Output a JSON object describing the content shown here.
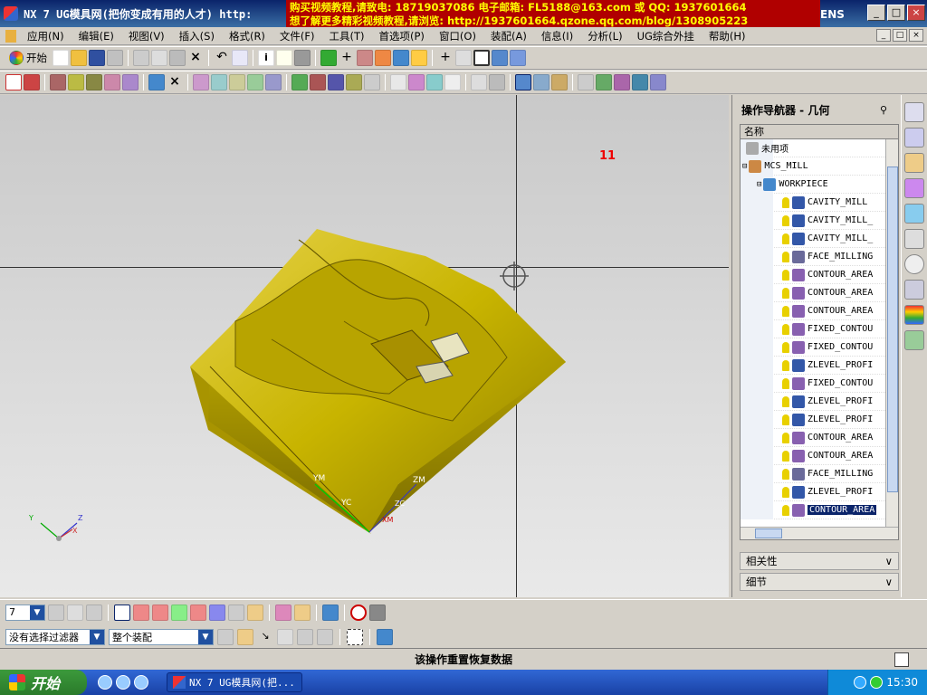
{
  "window": {
    "title": "NX 7 UG模具网(把你变成有用的人才) http:"
  },
  "ad": {
    "line1": "购买视频教程,请致电: 18719037086 电子邮箱: FL5188@163.com 或 QQ: 1937601664",
    "line2": "想了解更多精彩视频教程,请浏览: http://1937601664.qzone.qq.com/blog/1308905223",
    "brand_tag": "ENS"
  },
  "menu": [
    "应用(N)",
    "编辑(E)",
    "视图(V)",
    "插入(S)",
    "格式(R)",
    "文件(F)",
    "工具(T)",
    "首选项(P)",
    "窗口(O)",
    "装配(A)",
    "信息(I)",
    "分析(L)",
    "UG综合外挂",
    "帮助(H)"
  ],
  "toolbar": {
    "start_label": "开始"
  },
  "viewport": {
    "marker_label": "11",
    "labels": {
      "ym": "YM",
      "yc": "YC",
      "zm": "ZM",
      "zc": "ZC",
      "xm": "XM",
      "triad_y": "Y",
      "triad_z": "Z",
      "triad_x": "X"
    }
  },
  "navigator": {
    "title": "操作导航器 - 几何",
    "column_header": "名称",
    "items": [
      {
        "label": "未用项"
      },
      {
        "label": "MCS_MILL"
      },
      {
        "label": "WORKPIECE"
      },
      {
        "label": "CAVITY_MILL"
      },
      {
        "label": "CAVITY_MILL_"
      },
      {
        "label": "CAVITY_MILL_"
      },
      {
        "label": "FACE_MILLING"
      },
      {
        "label": "CONTOUR_AREA"
      },
      {
        "label": "CONTOUR_AREA"
      },
      {
        "label": "CONTOUR_AREA"
      },
      {
        "label": "FIXED_CONTOU"
      },
      {
        "label": "FIXED_CONTOU"
      },
      {
        "label": "ZLEVEL_PROFI"
      },
      {
        "label": "FIXED_CONTOU"
      },
      {
        "label": "ZLEVEL_PROFI"
      },
      {
        "label": "ZLEVEL_PROFI"
      },
      {
        "label": "CONTOUR_AREA"
      },
      {
        "label": "CONTOUR_AREA"
      },
      {
        "label": "FACE_MILLING"
      },
      {
        "label": "ZLEVEL_PROFI"
      },
      {
        "label": "CONTOUR_AREA"
      }
    ],
    "accordion": [
      "相关性",
      "细节"
    ]
  },
  "bottom": {
    "layer_value": "7",
    "filter_value": "没有选择过滤器",
    "scope_value": "整个装配"
  },
  "status": {
    "message": "该操作重置恢复数据"
  },
  "taskbar": {
    "start": "开始",
    "task": "NX 7 UG模具网(把...",
    "clock": "15:30"
  },
  "colors": {
    "model": "#c8b400",
    "title_bar": "#0a246a",
    "ad_bg": "#b00000",
    "ad_text": "#ffff00",
    "selection": "#0a246a"
  }
}
